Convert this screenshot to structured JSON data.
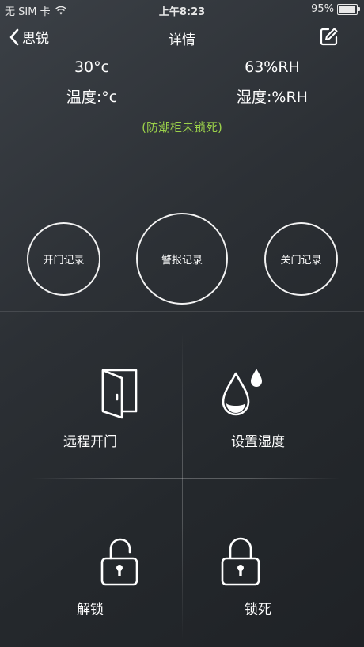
{
  "status_bar": {
    "carrier": "无 SIM 卡",
    "time": "上午8:23",
    "battery": "95%",
    "battery_level": 0.95
  },
  "nav": {
    "back_label": "思锐",
    "title": "详情"
  },
  "readings": {
    "temperature_value": "30°c",
    "temperature_label": "温度:°c",
    "humidity_value": "63%RH",
    "humidity_label": "湿度:%RH"
  },
  "lock_status": "(防潮柜未锁死)",
  "records": {
    "open_door": "开门记录",
    "alarm": "警报记录",
    "close_door": "关门记录"
  },
  "actions": {
    "remote_open": "远程开门",
    "set_humidity": "设置湿度",
    "unlock": "解锁",
    "lock": "锁死"
  },
  "colors": {
    "accent_green": "#9bd14a",
    "foreground": "#ffffff"
  }
}
